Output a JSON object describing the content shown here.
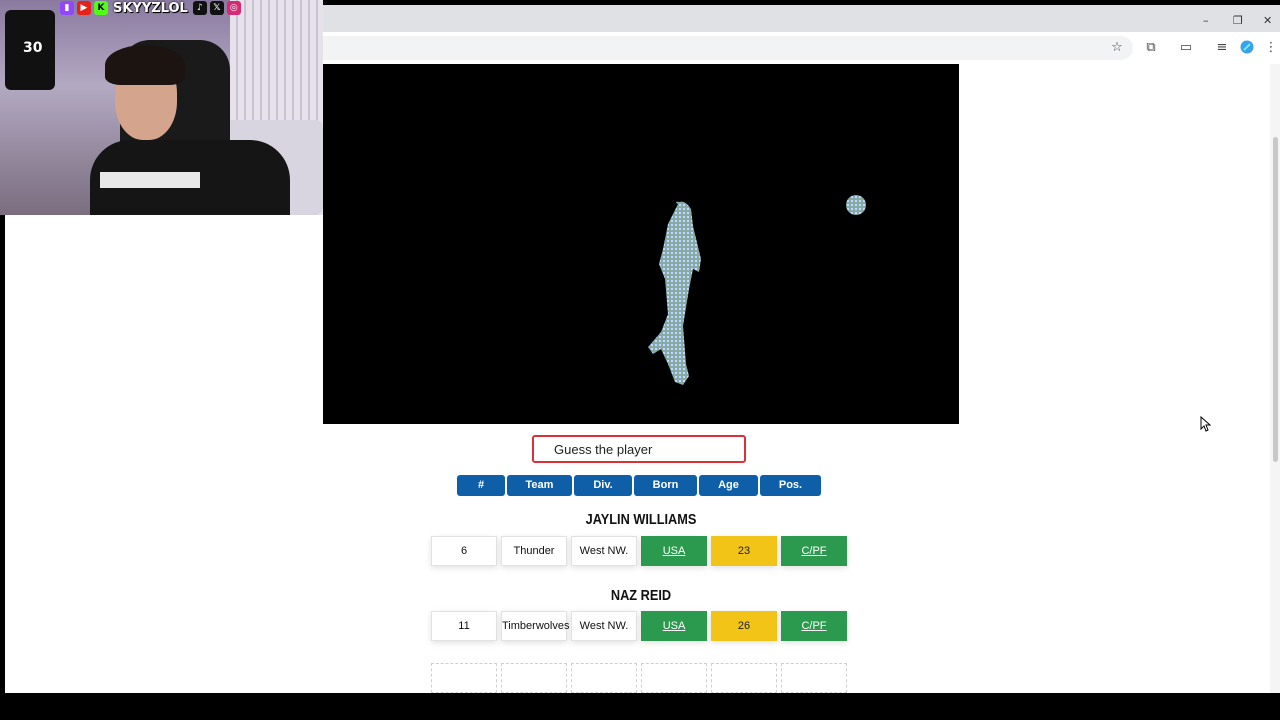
{
  "streamer": {
    "handle": "SKYYZLOL",
    "social_icons": [
      "twitch-icon",
      "youtube-icon",
      "kick-icon",
      "tiktok-icon",
      "x-icon",
      "instagram-icon"
    ],
    "jersey_number": "30"
  },
  "browser": {
    "window_controls": [
      "–",
      "❐",
      "✕"
    ],
    "toolbar_icons": [
      "bookmark-star-icon",
      "extensions-icon",
      "cast-icon",
      "media-icon",
      "profile-icon",
      "menu-icon"
    ]
  },
  "game": {
    "search": {
      "placeholder": "Guess the player"
    },
    "headers": [
      "#",
      "Team",
      "Div.",
      "Born",
      "Age",
      "Pos."
    ],
    "guesses": [
      {
        "name": "JAYLIN WILLIAMS",
        "cells": [
          {
            "value": "6",
            "status": "none"
          },
          {
            "value": "Thunder",
            "status": "none"
          },
          {
            "value": "West NW.",
            "status": "none"
          },
          {
            "value": "USA",
            "status": "correct"
          },
          {
            "value": "23",
            "status": "close"
          },
          {
            "value": "C/PF",
            "status": "correct"
          }
        ]
      },
      {
        "name": "NAZ REID",
        "cells": [
          {
            "value": "11",
            "status": "none"
          },
          {
            "value": "Timberwolves",
            "status": "none"
          },
          {
            "value": "West NW.",
            "status": "none"
          },
          {
            "value": "USA",
            "status": "correct"
          },
          {
            "value": "26",
            "status": "close"
          },
          {
            "value": "C/PF",
            "status": "correct"
          }
        ]
      }
    ],
    "colors": {
      "header": "#0f5ea8",
      "correct": "#2b9a4e",
      "close": "#f2c418",
      "input_border": "#d9303a"
    }
  }
}
